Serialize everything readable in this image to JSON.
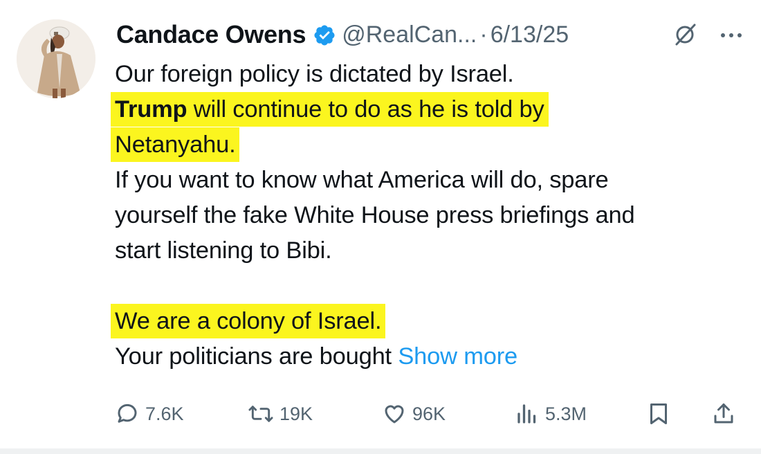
{
  "author": {
    "name": "Candace Owens",
    "handle": "@RealCan...",
    "separator": "·",
    "date": "6/13/25",
    "verified": true,
    "avatar_icon": "profile-photo"
  },
  "tweet": {
    "line1": "Our foreign policy is dictated by Israel.",
    "line2_bold": "Trump",
    "line2_rest": " will continue to do as he is told by",
    "line3": "Netanyahu.",
    "line4": "If you want to know what America will do, spare",
    "line5": "yourself the fake White House press briefings and",
    "line6": "start listening to Bibi.",
    "line8": "We are a colony of Israel.",
    "line9": "Your politicians are bought",
    "show_more": "Show more"
  },
  "actions": {
    "replies": "7.6K",
    "reposts": "19K",
    "likes": "96K",
    "views": "5.3M"
  },
  "colors": {
    "highlight": "#fbf51f",
    "link": "#1d9bf0",
    "secondary_text": "#536471",
    "verified_badge": "#1d9bf0"
  }
}
